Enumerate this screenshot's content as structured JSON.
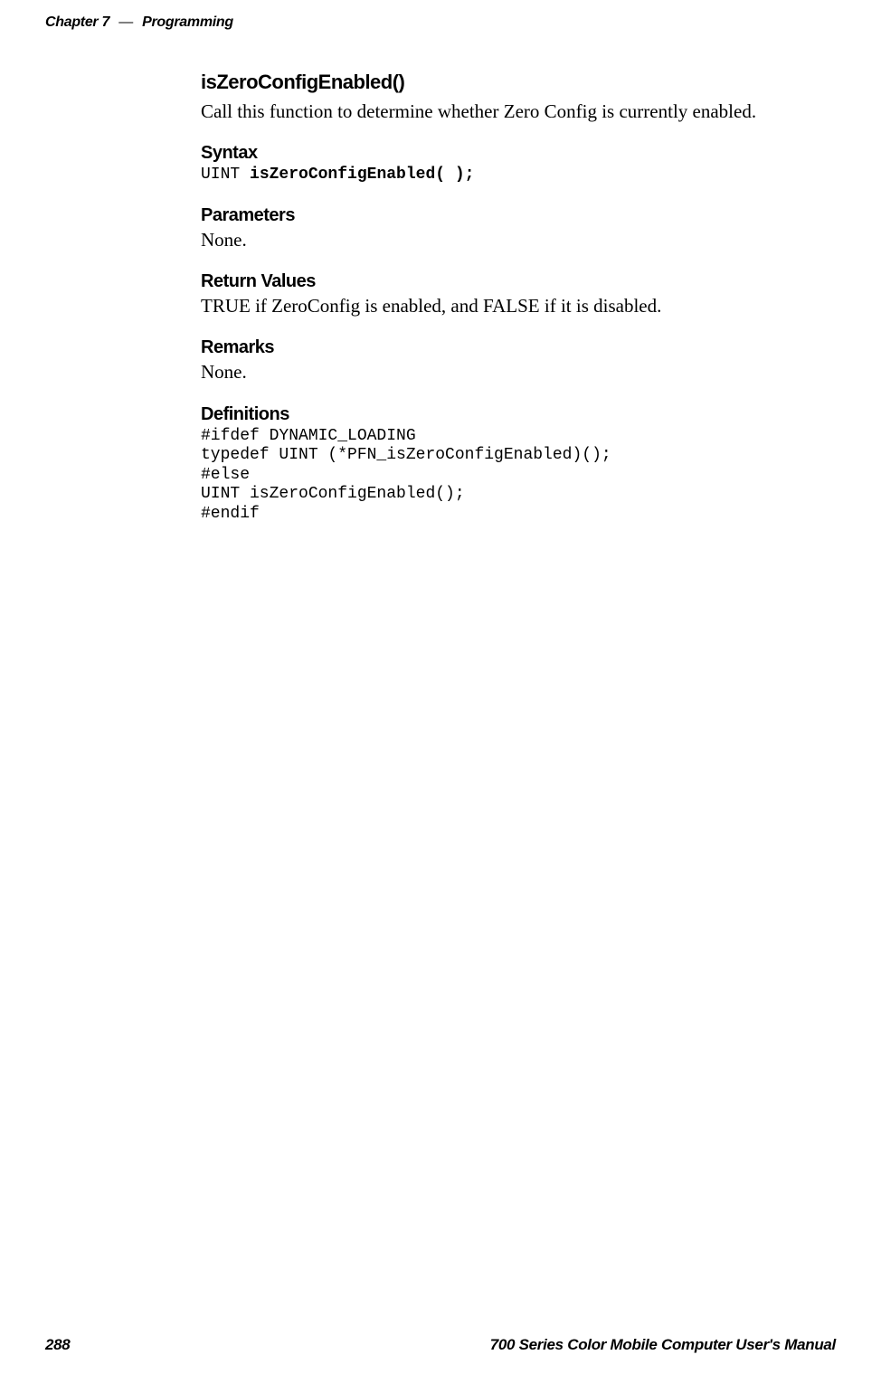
{
  "header": {
    "chapter": "Chapter 7",
    "separator": "—",
    "title": "Programming"
  },
  "content": {
    "functionTitle": "isZeroConfigEnabled()",
    "functionDescription": "Call this function to determine whether Zero Config is currently enabled.",
    "syntax": {
      "heading": "Syntax",
      "prefix": "UINT ",
      "bold": "isZeroConfigEnabled( );"
    },
    "parameters": {
      "heading": "Parameters",
      "text": "None."
    },
    "returnValues": {
      "heading": "Return Values",
      "text": "TRUE if ZeroConfig is enabled, and FALSE if it is disabled."
    },
    "remarks": {
      "heading": "Remarks",
      "text": "None."
    },
    "definitions": {
      "heading": "Definitions",
      "code": "#ifdef DYNAMIC_LOADING\ntypedef UINT (*PFN_isZeroConfigEnabled)();\n#else\nUINT isZeroConfigEnabled();\n#endif"
    }
  },
  "footer": {
    "pageNumber": "288",
    "manualTitle": "700 Series Color Mobile Computer User's Manual"
  }
}
